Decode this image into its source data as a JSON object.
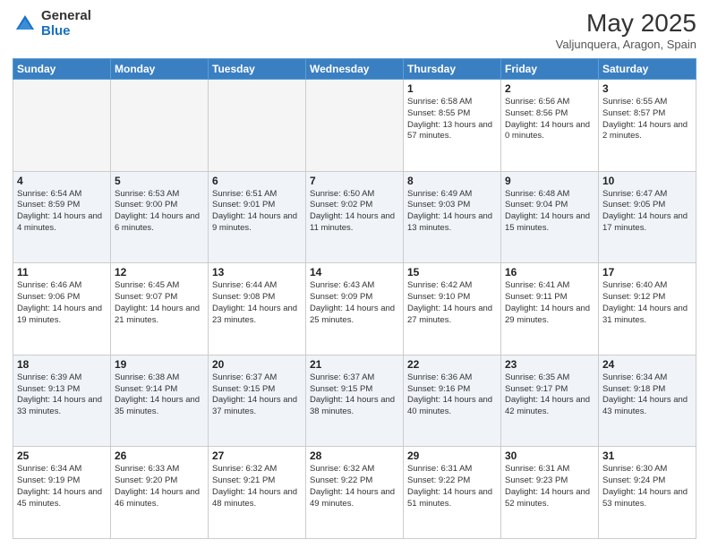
{
  "header": {
    "logo_line1": "General",
    "logo_line2": "Blue",
    "month": "May 2025",
    "location": "Valjunquera, Aragon, Spain"
  },
  "weekdays": [
    "Sunday",
    "Monday",
    "Tuesday",
    "Wednesday",
    "Thursday",
    "Friday",
    "Saturday"
  ],
  "weeks": [
    [
      {
        "day": "",
        "info": ""
      },
      {
        "day": "",
        "info": ""
      },
      {
        "day": "",
        "info": ""
      },
      {
        "day": "",
        "info": ""
      },
      {
        "day": "1",
        "info": "Sunrise: 6:58 AM\nSunset: 8:55 PM\nDaylight: 13 hours\nand 57 minutes."
      },
      {
        "day": "2",
        "info": "Sunrise: 6:56 AM\nSunset: 8:56 PM\nDaylight: 14 hours\nand 0 minutes."
      },
      {
        "day": "3",
        "info": "Sunrise: 6:55 AM\nSunset: 8:57 PM\nDaylight: 14 hours\nand 2 minutes."
      }
    ],
    [
      {
        "day": "4",
        "info": "Sunrise: 6:54 AM\nSunset: 8:59 PM\nDaylight: 14 hours\nand 4 minutes."
      },
      {
        "day": "5",
        "info": "Sunrise: 6:53 AM\nSunset: 9:00 PM\nDaylight: 14 hours\nand 6 minutes."
      },
      {
        "day": "6",
        "info": "Sunrise: 6:51 AM\nSunset: 9:01 PM\nDaylight: 14 hours\nand 9 minutes."
      },
      {
        "day": "7",
        "info": "Sunrise: 6:50 AM\nSunset: 9:02 PM\nDaylight: 14 hours\nand 11 minutes."
      },
      {
        "day": "8",
        "info": "Sunrise: 6:49 AM\nSunset: 9:03 PM\nDaylight: 14 hours\nand 13 minutes."
      },
      {
        "day": "9",
        "info": "Sunrise: 6:48 AM\nSunset: 9:04 PM\nDaylight: 14 hours\nand 15 minutes."
      },
      {
        "day": "10",
        "info": "Sunrise: 6:47 AM\nSunset: 9:05 PM\nDaylight: 14 hours\nand 17 minutes."
      }
    ],
    [
      {
        "day": "11",
        "info": "Sunrise: 6:46 AM\nSunset: 9:06 PM\nDaylight: 14 hours\nand 19 minutes."
      },
      {
        "day": "12",
        "info": "Sunrise: 6:45 AM\nSunset: 9:07 PM\nDaylight: 14 hours\nand 21 minutes."
      },
      {
        "day": "13",
        "info": "Sunrise: 6:44 AM\nSunset: 9:08 PM\nDaylight: 14 hours\nand 23 minutes."
      },
      {
        "day": "14",
        "info": "Sunrise: 6:43 AM\nSunset: 9:09 PM\nDaylight: 14 hours\nand 25 minutes."
      },
      {
        "day": "15",
        "info": "Sunrise: 6:42 AM\nSunset: 9:10 PM\nDaylight: 14 hours\nand 27 minutes."
      },
      {
        "day": "16",
        "info": "Sunrise: 6:41 AM\nSunset: 9:11 PM\nDaylight: 14 hours\nand 29 minutes."
      },
      {
        "day": "17",
        "info": "Sunrise: 6:40 AM\nSunset: 9:12 PM\nDaylight: 14 hours\nand 31 minutes."
      }
    ],
    [
      {
        "day": "18",
        "info": "Sunrise: 6:39 AM\nSunset: 9:13 PM\nDaylight: 14 hours\nand 33 minutes."
      },
      {
        "day": "19",
        "info": "Sunrise: 6:38 AM\nSunset: 9:14 PM\nDaylight: 14 hours\nand 35 minutes."
      },
      {
        "day": "20",
        "info": "Sunrise: 6:37 AM\nSunset: 9:15 PM\nDaylight: 14 hours\nand 37 minutes."
      },
      {
        "day": "21",
        "info": "Sunrise: 6:37 AM\nSunset: 9:15 PM\nDaylight: 14 hours\nand 38 minutes."
      },
      {
        "day": "22",
        "info": "Sunrise: 6:36 AM\nSunset: 9:16 PM\nDaylight: 14 hours\nand 40 minutes."
      },
      {
        "day": "23",
        "info": "Sunrise: 6:35 AM\nSunset: 9:17 PM\nDaylight: 14 hours\nand 42 minutes."
      },
      {
        "day": "24",
        "info": "Sunrise: 6:34 AM\nSunset: 9:18 PM\nDaylight: 14 hours\nand 43 minutes."
      }
    ],
    [
      {
        "day": "25",
        "info": "Sunrise: 6:34 AM\nSunset: 9:19 PM\nDaylight: 14 hours\nand 45 minutes."
      },
      {
        "day": "26",
        "info": "Sunrise: 6:33 AM\nSunset: 9:20 PM\nDaylight: 14 hours\nand 46 minutes."
      },
      {
        "day": "27",
        "info": "Sunrise: 6:32 AM\nSunset: 9:21 PM\nDaylight: 14 hours\nand 48 minutes."
      },
      {
        "day": "28",
        "info": "Sunrise: 6:32 AM\nSunset: 9:22 PM\nDaylight: 14 hours\nand 49 minutes."
      },
      {
        "day": "29",
        "info": "Sunrise: 6:31 AM\nSunset: 9:22 PM\nDaylight: 14 hours\nand 51 minutes."
      },
      {
        "day": "30",
        "info": "Sunrise: 6:31 AM\nSunset: 9:23 PM\nDaylight: 14 hours\nand 52 minutes."
      },
      {
        "day": "31",
        "info": "Sunrise: 6:30 AM\nSunset: 9:24 PM\nDaylight: 14 hours\nand 53 minutes."
      }
    ]
  ]
}
